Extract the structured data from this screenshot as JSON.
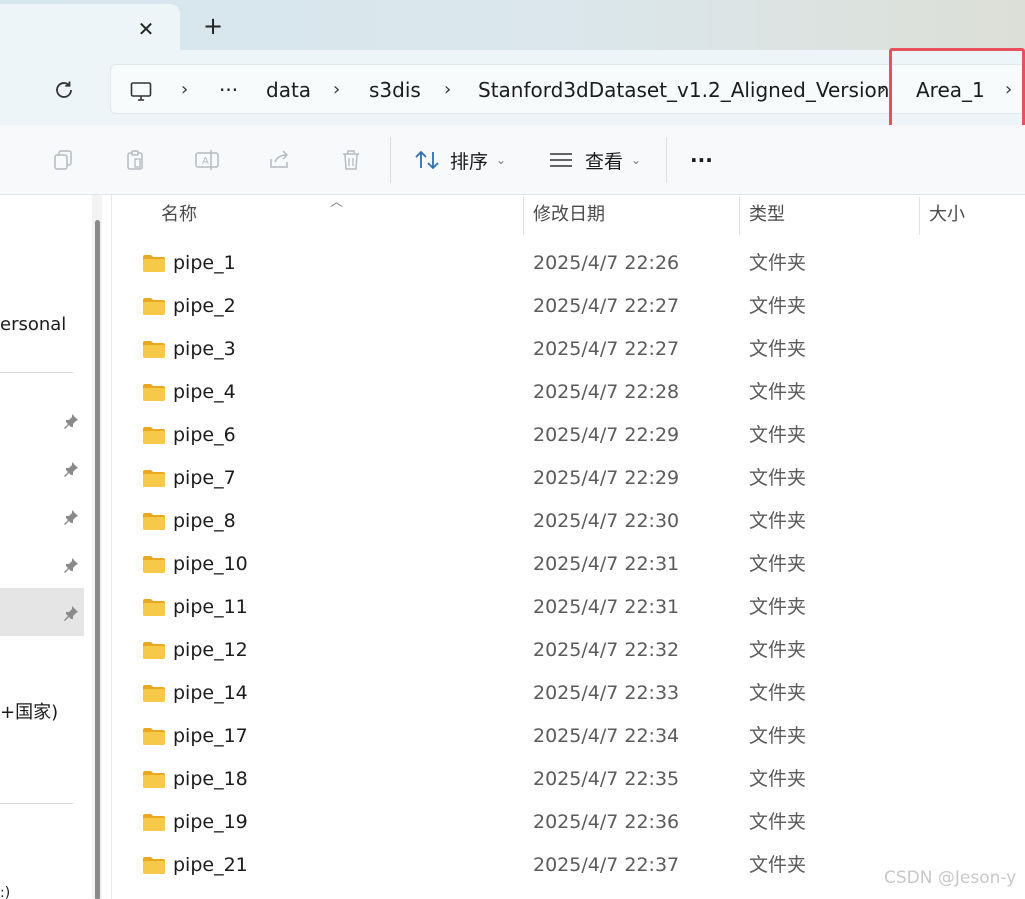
{
  "tab": {
    "close_icon": "close-icon",
    "new_tab_icon": "plus-icon"
  },
  "addressbar": {
    "refresh_icon": "refresh-icon",
    "computer_icon": "computer-icon",
    "overflow": "···",
    "crumbs": [
      "data",
      "s3dis",
      "Stanford3dDataset_v1.2_Aligned_Version",
      "Area_1"
    ],
    "separator": "›"
  },
  "commandbar": {
    "sort_label": "排序",
    "view_label": "查看",
    "more_label": "···"
  },
  "nav": {
    "personal_label": "ersonal",
    "country_label": "+国家)",
    "bottom_fragment": ":)"
  },
  "columns": {
    "name": "名称",
    "modified": "修改日期",
    "type": "类型",
    "size": "大小"
  },
  "files": [
    {
      "name": "pipe_1",
      "modified": "2025/4/7 22:26",
      "type": "文件夹"
    },
    {
      "name": "pipe_2",
      "modified": "2025/4/7 22:27",
      "type": "文件夹"
    },
    {
      "name": "pipe_3",
      "modified": "2025/4/7 22:27",
      "type": "文件夹"
    },
    {
      "name": "pipe_4",
      "modified": "2025/4/7 22:28",
      "type": "文件夹"
    },
    {
      "name": "pipe_6",
      "modified": "2025/4/7 22:29",
      "type": "文件夹"
    },
    {
      "name": "pipe_7",
      "modified": "2025/4/7 22:29",
      "type": "文件夹"
    },
    {
      "name": "pipe_8",
      "modified": "2025/4/7 22:30",
      "type": "文件夹"
    },
    {
      "name": "pipe_10",
      "modified": "2025/4/7 22:31",
      "type": "文件夹"
    },
    {
      "name": "pipe_11",
      "modified": "2025/4/7 22:31",
      "type": "文件夹"
    },
    {
      "name": "pipe_12",
      "modified": "2025/4/7 22:32",
      "type": "文件夹"
    },
    {
      "name": "pipe_14",
      "modified": "2025/4/7 22:33",
      "type": "文件夹"
    },
    {
      "name": "pipe_17",
      "modified": "2025/4/7 22:34",
      "type": "文件夹"
    },
    {
      "name": "pipe_18",
      "modified": "2025/4/7 22:35",
      "type": "文件夹"
    },
    {
      "name": "pipe_19",
      "modified": "2025/4/7 22:36",
      "type": "文件夹"
    },
    {
      "name": "pipe_21",
      "modified": "2025/4/7 22:37",
      "type": "文件夹"
    }
  ],
  "watermark": "CSDN @Jeson-y",
  "colors": {
    "highlight": "#e8505b",
    "folder": "#f7c948"
  }
}
